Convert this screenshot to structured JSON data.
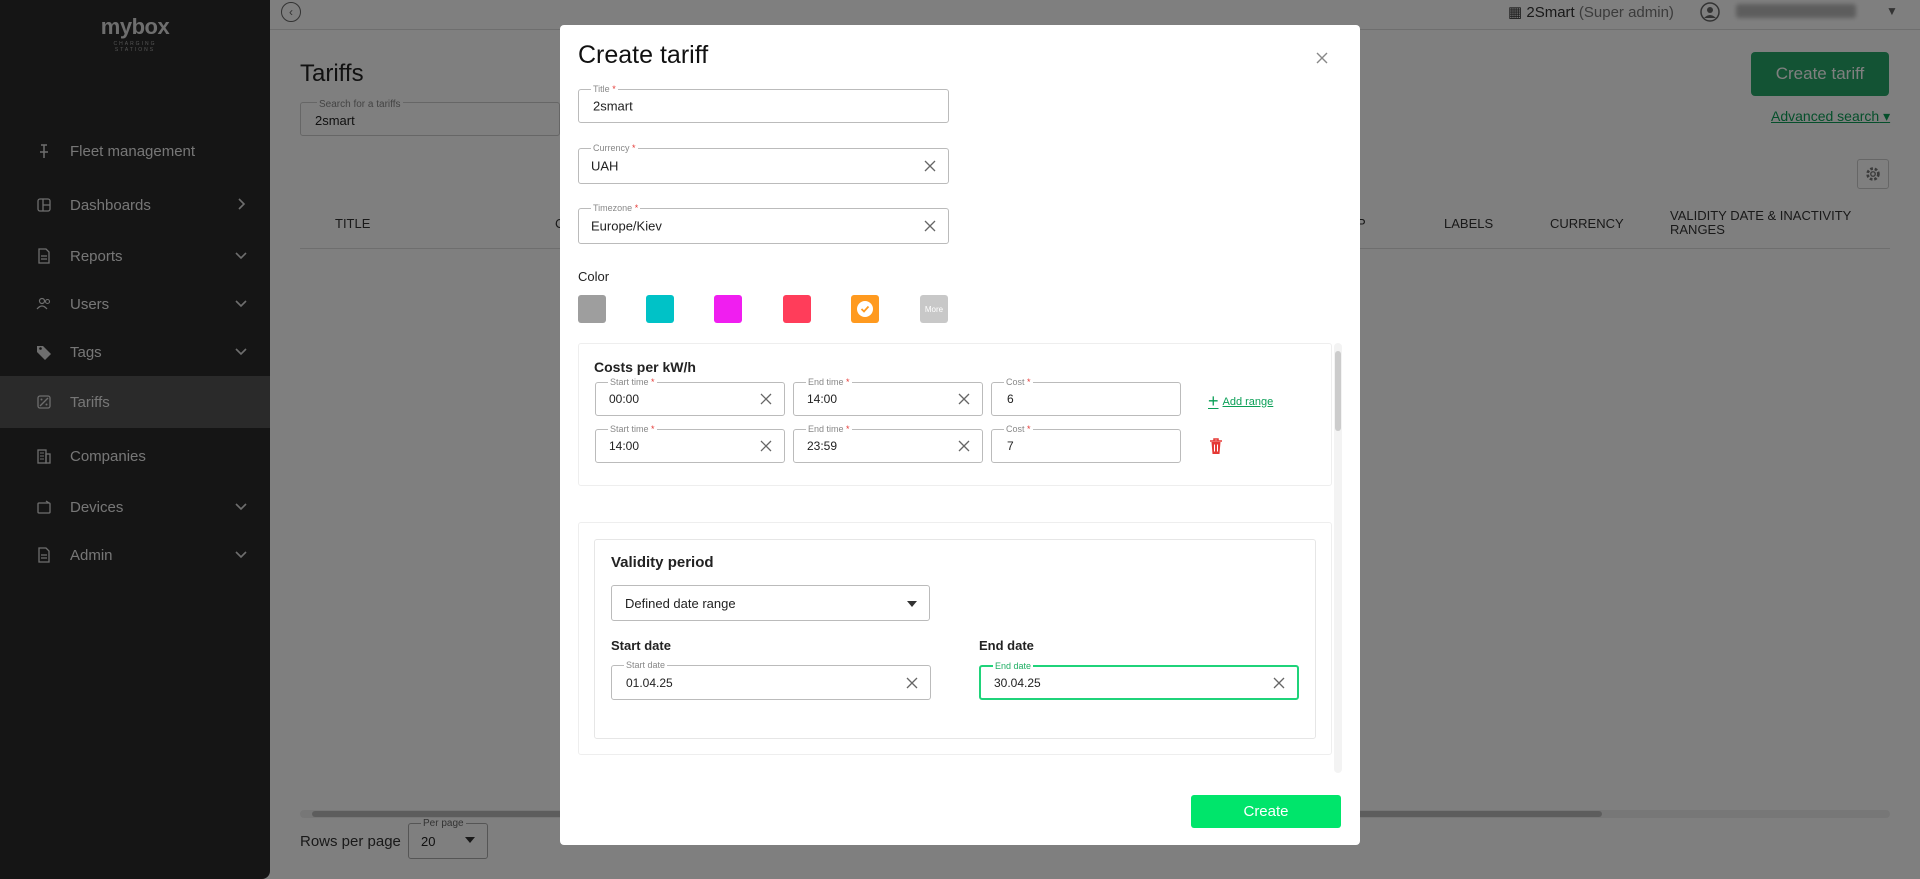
{
  "sidebar": {
    "logo": {
      "wordmark": "mybox",
      "tagline": "CHARGING STATIONS"
    },
    "items": [
      {
        "label": "Fleet management",
        "icon": "pin-icon"
      },
      {
        "label": "Dashboards",
        "icon": "dashboard-icon"
      },
      {
        "label": "Reports",
        "icon": "document-icon"
      },
      {
        "label": "Users",
        "icon": "users-icon"
      },
      {
        "label": "Tags",
        "icon": "tag-icon"
      },
      {
        "label": "Tariffs",
        "icon": "tariff-icon",
        "active": true
      },
      {
        "label": "Companies",
        "icon": "building-icon"
      },
      {
        "label": "Devices",
        "icon": "device-icon"
      },
      {
        "label": "Admin",
        "icon": "document-icon"
      }
    ]
  },
  "header": {
    "company": "2Smart",
    "role": "(Super admin)"
  },
  "page": {
    "title": "Tariffs",
    "search": {
      "label": "Search for a tariffs",
      "value": "2smart"
    },
    "create_button": "Create tariff",
    "advanced_search": "Advanced search",
    "columns": [
      "TITLE",
      "C",
      "P",
      "LABELS",
      "CURRENCY",
      "VALIDITY DATE & INACTIVITY RANGES"
    ],
    "rows_per_page_label": "Rows per page",
    "per_page": {
      "label": "Per page",
      "value": "20"
    }
  },
  "modal": {
    "title": "Create tariff",
    "title_field": {
      "label": "Title",
      "value": "2smart"
    },
    "currency_field": {
      "label": "Currency",
      "value": "UAH"
    },
    "timezone_field": {
      "label": "Timezone",
      "value": "Europe/Kiev"
    },
    "color_label": "Color",
    "colors": [
      "#9e9e9e",
      "#00c2c7",
      "#f01ef0",
      "#ff3d5a",
      "#ff9a1f",
      "#c8c8c8"
    ],
    "selected_color_index": 4,
    "more_label": "More",
    "costs": {
      "title": "Costs per kW/h",
      "start_label": "Start time",
      "end_label": "End time",
      "cost_label": "Cost",
      "ranges": [
        {
          "start": "00:00",
          "end": "14:00",
          "cost": "6"
        },
        {
          "start": "14:00",
          "end": "23:59",
          "cost": "7"
        }
      ],
      "add_range": "Add range"
    },
    "validity": {
      "title": "Validity period",
      "mode": "Defined date range",
      "start_heading": "Start date",
      "end_heading": "End date",
      "start_label": "Start date",
      "end_label": "End date",
      "start_value": "01.04.25",
      "end_value": "30.04.25"
    },
    "create_button": "Create"
  }
}
